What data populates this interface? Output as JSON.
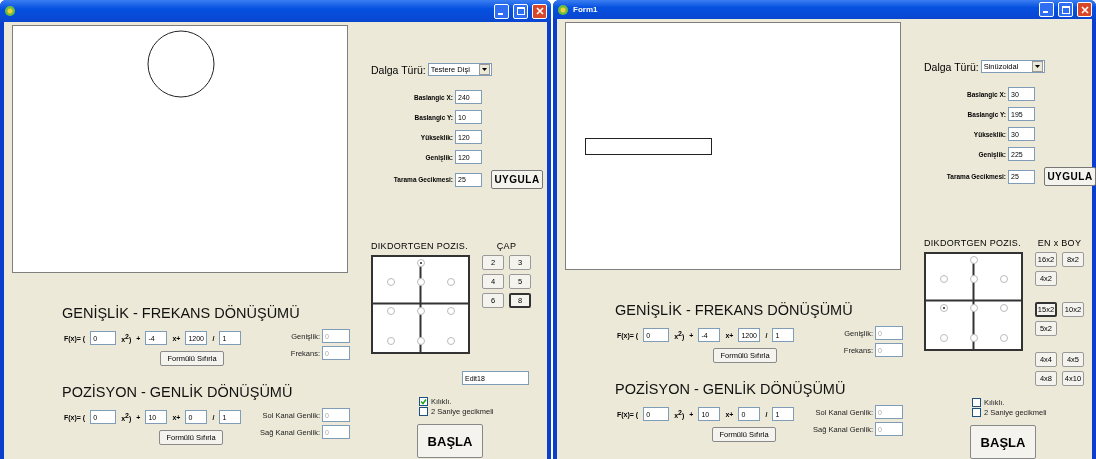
{
  "windows": [
    {
      "canvas": {
        "kind": "circle"
      },
      "wave": {
        "label": "Dalga Türü:",
        "value": "Testere Dişi"
      },
      "params": [
        {
          "label": "Baslangic X:",
          "value": "240"
        },
        {
          "label": "Baslangic Y:",
          "value": "10"
        },
        {
          "label": "Yükseklik:",
          "value": "120"
        },
        {
          "label": "Genişlik:",
          "value": "120"
        },
        {
          "label": "Tarama Gecikmesi:",
          "value": "25"
        }
      ],
      "apply_button": "UYGULA",
      "position": {
        "title": "DIKDORTGEN POZIS.",
        "radios": [
          {
            "selected": true
          },
          {
            "selected": false
          },
          {
            "selected": false
          },
          {
            "selected": false
          },
          {
            "selected": false
          },
          {
            "selected": false
          },
          {
            "selected": false
          },
          {
            "selected": false
          },
          {
            "selected": false
          },
          {
            "selected": false
          }
        ]
      },
      "size": {
        "title": "ÇAP",
        "groups": [
          [
            {
              "label": "2",
              "selected": false
            },
            {
              "label": "3",
              "selected": false
            },
            {
              "label": "4",
              "selected": false
            },
            {
              "label": "5",
              "selected": false
            },
            {
              "label": "6",
              "selected": false
            },
            {
              "label": "8",
              "selected": true
            }
          ]
        ]
      },
      "edit_field": {
        "value": "Edit18"
      },
      "checkboxes": [
        {
          "label": "Kılıklı.",
          "checked": true
        },
        {
          "label": "2 Saniye gecikmeli",
          "checked": false
        }
      ],
      "start_button": "BAŞLA",
      "sections": [
        {
          "title": "GENİŞLİK - FREKANS DÖNÜŞÜMÜ",
          "formula": [
            {
              "kind": "text",
              "text": "F(x)= ("
            },
            {
              "kind": "input",
              "value": "0"
            },
            {
              "kind": "text",
              "text": "x$^{2}$)"
            },
            {
              "kind": "text",
              "text": "+"
            },
            {
              "kind": "input",
              "value": "-4"
            },
            {
              "kind": "text",
              "text": "x+"
            },
            {
              "kind": "input",
              "value": "1200"
            },
            {
              "kind": "text",
              "text": "/"
            },
            {
              "kind": "input",
              "value": "1"
            }
          ],
          "reset_button": "Formülü Sıfırla",
          "outputs": [
            {
              "label": "Genişlik:",
              "value": "0",
              "disabled": true
            },
            {
              "label": "Frekans:",
              "value": "0",
              "disabled": true
            }
          ]
        },
        {
          "title": "POZİSYON - GENLİK DÖNÜŞÜMÜ",
          "formula": [
            {
              "kind": "text",
              "text": "F(x)= ("
            },
            {
              "kind": "input",
              "value": "0"
            },
            {
              "kind": "text",
              "text": "x$^{2}$)"
            },
            {
              "kind": "text",
              "text": "+"
            },
            {
              "kind": "input",
              "value": "10"
            },
            {
              "kind": "text",
              "text": "x+"
            },
            {
              "kind": "input",
              "value": "0"
            },
            {
              "kind": "text",
              "text": "/"
            },
            {
              "kind": "input",
              "value": "1"
            }
          ],
          "reset_button": "Formülü Sıfırla",
          "outputs": [
            {
              "label": "Sol Kanal Genlik:",
              "value": "0",
              "disabled": true
            },
            {
              "label": "Sağ Kanal Genlik:",
              "value": "0",
              "disabled": true
            }
          ]
        }
      ]
    },
    {
      "title": "Form1",
      "canvas": {
        "kind": "rectangle"
      },
      "wave": {
        "label": "Dalga Türü:",
        "value": "Sinüzoidal"
      },
      "params": [
        {
          "label": "Baslangic X:",
          "value": "30"
        },
        {
          "label": "Baslangic Y:",
          "value": "195"
        },
        {
          "label": "Yükseklik:",
          "value": "30"
        },
        {
          "label": "Genişlik:",
          "value": "225"
        },
        {
          "label": "Tarama Gecikmesi:",
          "value": "25"
        }
      ],
      "apply_button": "UYGULA",
      "position": {
        "title": "DIKDORTGEN POZIS.",
        "radios": [
          {
            "selected": false
          },
          {
            "selected": false
          },
          {
            "selected": false
          },
          {
            "selected": false
          },
          {
            "selected": true
          },
          {
            "selected": false
          },
          {
            "selected": false
          },
          {
            "selected": false
          },
          {
            "selected": false
          },
          {
            "selected": false
          }
        ]
      },
      "size": {
        "title": "EN x BOY",
        "groups": [
          [
            {
              "label": "16x2",
              "selected": false
            },
            {
              "label": "8x2",
              "selected": false
            },
            {
              "label": "4x2",
              "selected": false
            }
          ],
          [
            {
              "label": "15x2",
              "selected": true
            },
            {
              "label": "10x2",
              "selected": false
            },
            {
              "label": "5x2",
              "selected": false
            }
          ],
          [
            {
              "label": "4x4",
              "selected": false
            },
            {
              "label": "4x5",
              "selected": false
            },
            {
              "label": "4x8",
              "selected": false
            },
            {
              "label": "4x10",
              "selected": false
            }
          ]
        ]
      },
      "checkboxes": [
        {
          "label": "Kılıklı.",
          "checked": false
        },
        {
          "label": "2 Saniye gecikmeli",
          "checked": false
        }
      ],
      "start_button": "BAŞLA",
      "sections": [
        {
          "title": "GENİŞLİK - FREKANS DÖNÜŞÜMÜ",
          "formula": [
            {
              "kind": "text",
              "text": "F(x)= ("
            },
            {
              "kind": "input",
              "value": "0"
            },
            {
              "kind": "text",
              "text": "x$^{2}$)"
            },
            {
              "kind": "text",
              "text": "+"
            },
            {
              "kind": "input",
              "value": "-4"
            },
            {
              "kind": "text",
              "text": "x+"
            },
            {
              "kind": "input",
              "value": "1200"
            },
            {
              "kind": "text",
              "text": "/"
            },
            {
              "kind": "input",
              "value": "1"
            }
          ],
          "reset_button": "Formülü Sıfırla",
          "outputs": [
            {
              "label": "Genişlik:",
              "value": "0",
              "disabled": true
            },
            {
              "label": "Frekans:",
              "value": "0",
              "disabled": true
            }
          ]
        },
        {
          "title": "POZİSYON - GENLİK DÖNÜŞÜMÜ",
          "formula": [
            {
              "kind": "text",
              "text": "F(x)= ("
            },
            {
              "kind": "input",
              "value": "0"
            },
            {
              "kind": "text",
              "text": "x$^{2}$)"
            },
            {
              "kind": "text",
              "text": "+"
            },
            {
              "kind": "input",
              "value": "10"
            },
            {
              "kind": "text",
              "text": "x+"
            },
            {
              "kind": "input",
              "value": "0"
            },
            {
              "kind": "text",
              "text": "/"
            },
            {
              "kind": "input",
              "value": "1"
            }
          ],
          "reset_button": "Formülü Sıfırla",
          "outputs": [
            {
              "label": "Sol Kanal Genlik:",
              "value": "0",
              "disabled": true
            },
            {
              "label": "Sağ Kanal Genlik:",
              "value": "0",
              "disabled": true
            }
          ]
        }
      ]
    }
  ]
}
